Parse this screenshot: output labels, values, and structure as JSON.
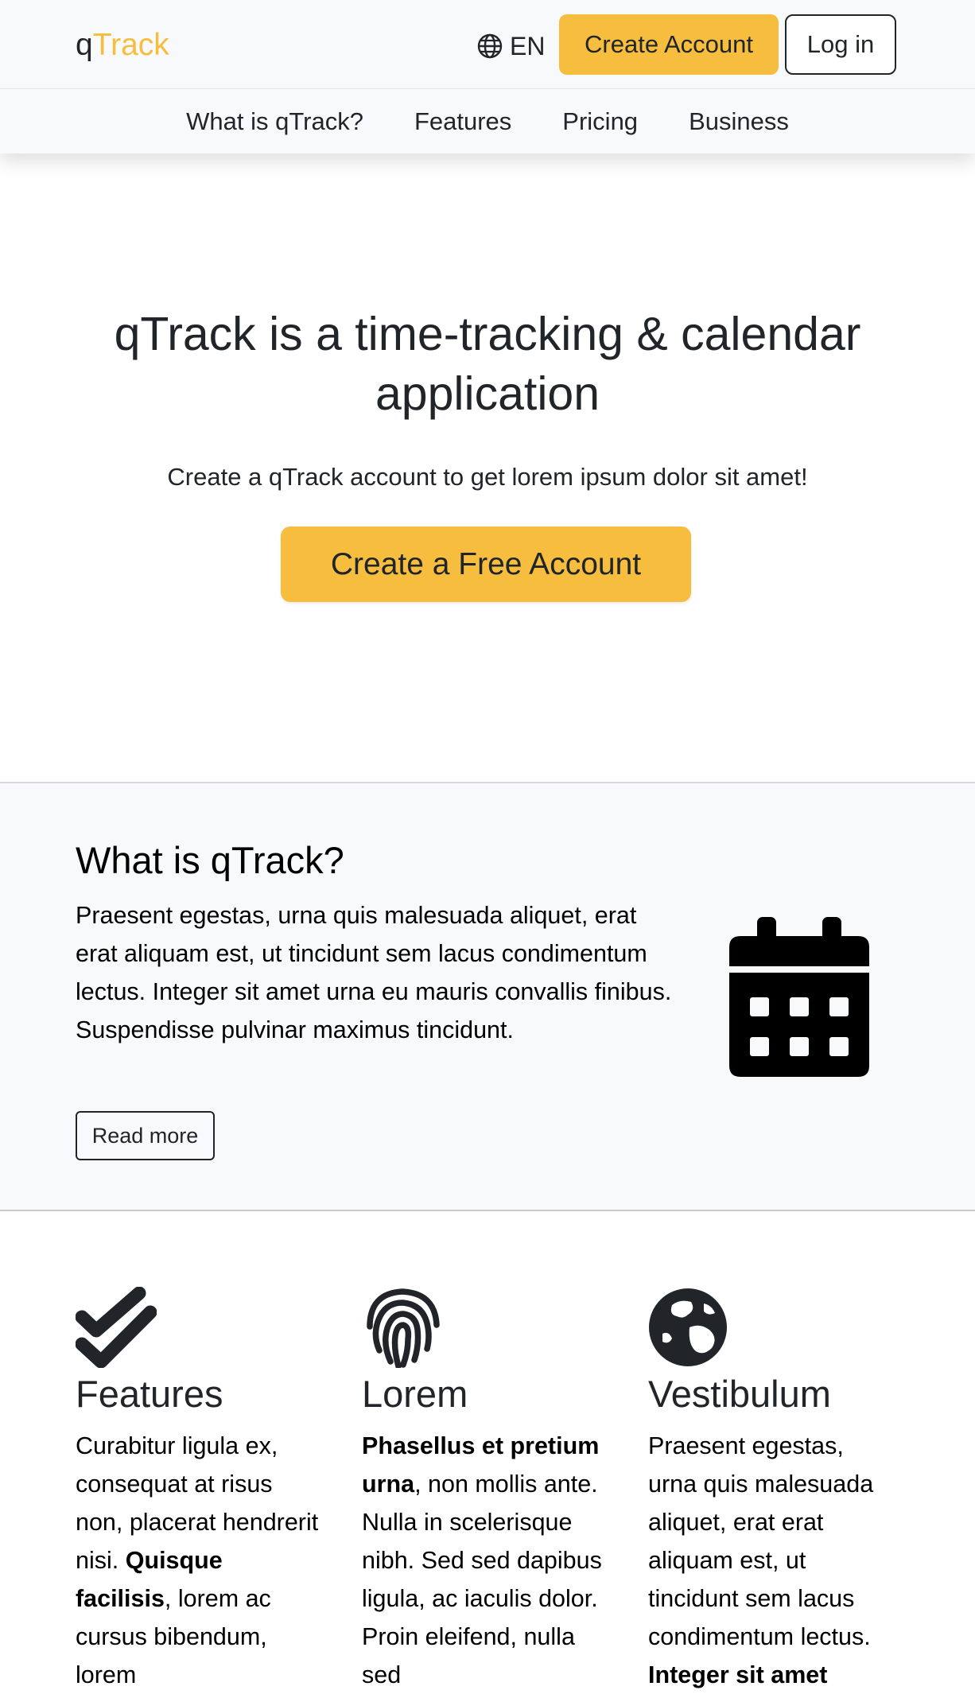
{
  "brand": {
    "prefix": "q",
    "suffix": "Track"
  },
  "header": {
    "language": "EN",
    "create_account": "Create Account",
    "login": "Log in"
  },
  "nav": {
    "items": [
      {
        "label": "What is qTrack?"
      },
      {
        "label": "Features"
      },
      {
        "label": "Pricing"
      },
      {
        "label": "Business"
      }
    ]
  },
  "hero": {
    "title": "qTrack is a time-tracking & calendar application",
    "subtitle": "Create a qTrack account to get lorem ipsum dolor sit amet!",
    "cta": "Create a Free Account"
  },
  "about": {
    "title": "What is qTrack?",
    "text": "Praesent egestas, urna quis malesuada aliquet, erat erat aliquam est, ut tincidunt sem lacus condimentum lectus. Integer sit amet urna eu mauris convallis finibus. Suspendisse pulvinar maximus tincidunt.",
    "read_more": "Read more",
    "icon": "calendar-icon"
  },
  "features": {
    "columns": [
      {
        "icon": "double-check-icon",
        "title": "Features",
        "text_1": "Curabitur ligula ex, consequat at risus non, placerat hendrerit nisi. ",
        "bold": "Quisque facilisis",
        "text_2": ", lorem ac cursus bibendum, lorem"
      },
      {
        "icon": "fingerprint-icon",
        "title": "Lorem",
        "bold": "Phasellus et pretium urna",
        "text_2": ", non mollis ante. Nulla in scelerisque nibh. Sed sed dapibus ligula, ac iaculis dolor. Proin eleifend, nulla sed"
      },
      {
        "icon": "globe-earth-icon",
        "title": "Vestibulum",
        "text_1": "Praesent egestas, urna quis malesuada aliquet, erat erat aliquam est, ut tincidunt sem lacus condimentum lectus. ",
        "bold": "Integer sit amet"
      }
    ]
  },
  "colors": {
    "accent": "#f6bd3f",
    "text": "#212529",
    "section_bg": "#f8f9fa"
  }
}
